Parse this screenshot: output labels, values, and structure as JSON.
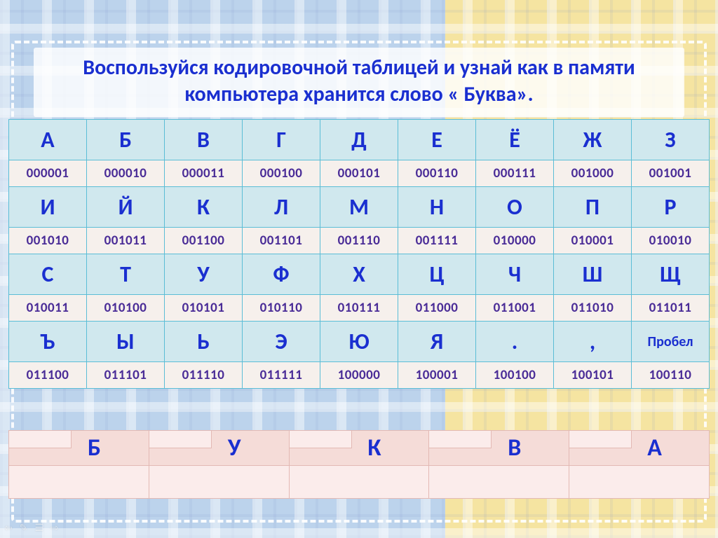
{
  "title": "Воспользуйся кодировочной таблицей  и узнай как в памяти компьютера хранится слово « Буква».",
  "rows": [
    {
      "letters": [
        "А",
        "Б",
        "В",
        "Г",
        "Д",
        "Е",
        "Ё",
        "Ж",
        "З"
      ],
      "codes": [
        "000001",
        "000010",
        "000011",
        "000100",
        "000101",
        "000110",
        "000111",
        "001000",
        "001001"
      ]
    },
    {
      "letters": [
        "И",
        "Й",
        "К",
        "Л",
        "М",
        "Н",
        "О",
        "П",
        "Р"
      ],
      "codes": [
        "001010",
        "001011",
        "001100",
        "001101",
        "001110",
        "001111",
        "010000",
        "010001",
        "010010"
      ]
    },
    {
      "letters": [
        "С",
        "Т",
        "У",
        "Ф",
        "Х",
        "Ц",
        "Ч",
        "Ш",
        "Щ"
      ],
      "codes": [
        "010011",
        "010100",
        "010101",
        "010110",
        "010111",
        "011000",
        "011001",
        "011010",
        "011011"
      ]
    },
    {
      "letters": [
        "Ъ",
        "Ы",
        "Ь",
        "Э",
        "Ю",
        "Я",
        ".",
        ",",
        "Пробел"
      ],
      "codes": [
        "011100",
        "011101",
        "011110",
        "011111",
        "100000",
        "100001",
        "100100",
        "100101",
        "100110"
      ]
    }
  ],
  "answer": [
    "Б",
    "У",
    "К",
    "В",
    "А"
  ]
}
